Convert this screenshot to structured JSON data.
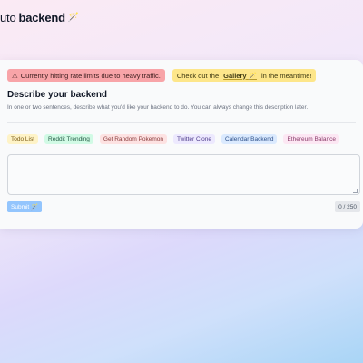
{
  "header": {
    "brand_left": "uto",
    "brand_right": "backend",
    "brand_icon": "🪄"
  },
  "banners": {
    "warning_icon": "⚠",
    "warning_text": "Currently hitting rate limits due to heavy traffic.",
    "info_prefix": "Check out the",
    "info_link": "Gallery",
    "info_link_icon": "🪄",
    "info_suffix": "in the meantime!"
  },
  "form": {
    "title": "Describe your backend",
    "description": "In one or two sentences, describe what you'd like your backend to do. You can always change this description later.",
    "textarea_value": "",
    "submit_label": "Submit",
    "submit_icon": "🪄",
    "char_counter": "0 / 250"
  },
  "examples": [
    "Todo List",
    "Reddit Trending",
    "Get Random Pokemon",
    "Twitter Clone",
    "Calendar Backend",
    "Ethereum Balance"
  ]
}
